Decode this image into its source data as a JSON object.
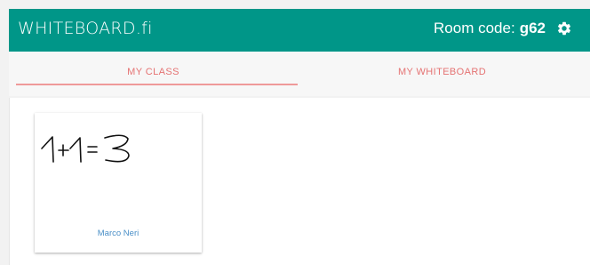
{
  "header": {
    "logo": "WHITEBOARD.fi",
    "room_label": "Room code:",
    "room_code": "g62",
    "settings_icon": "gear-icon"
  },
  "tabs": [
    {
      "label": "MY CLASS",
      "active": true
    },
    {
      "label": "MY WHITEBOARD",
      "active": false
    }
  ],
  "class_boards": [
    {
      "student": "Marco Neri",
      "content": "1+1=3"
    }
  ],
  "colors": {
    "header": "#009688",
    "tab_text": "#e57373",
    "student_name": "#4a8fc7"
  }
}
